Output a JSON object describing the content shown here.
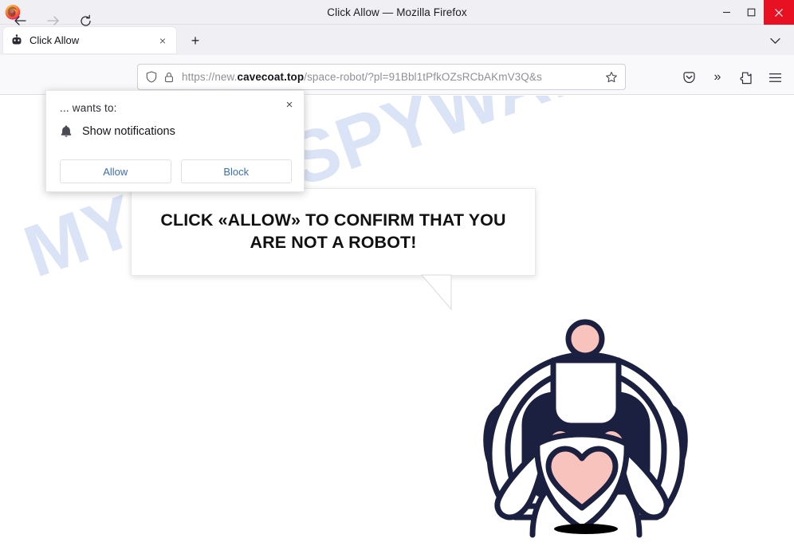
{
  "window": {
    "title": "Click Allow — Mozilla Firefox",
    "minimize_label": "minimize-icon",
    "maximize_label": "maximize-icon",
    "close_label": "close-icon"
  },
  "tabbar": {
    "tab_title": "Click Allow",
    "tab_close": "×",
    "new_tab": "+",
    "list_all_tabs": "chevron-down-icon"
  },
  "toolbar": {
    "back": "back-arrow-icon",
    "forward": "forward-arrow-icon",
    "reload": "reload-icon",
    "pocket": "pocket-icon",
    "more": "»",
    "extensions": "extensions-icon",
    "menu": "hamburger-menu-icon"
  },
  "urlbar": {
    "scheme": "https://",
    "subdomain": "new.",
    "domain": "cavecoat.top",
    "path": "/space-robot/?pl=91Bbl1tPfkOZsRCbAKmV3Q&s",
    "full_url": "https://new.cavecoat.top/space-robot/?pl=91Bbl1tPfkOZsRCbAKmV3Q&s",
    "shield_icon": "tracking-protection-shield-icon",
    "lock_icon": "padlock-icon",
    "bookmark_icon": "star-icon"
  },
  "permission_popup": {
    "origin_text": "... wants to:",
    "permission_label": "Show notifications",
    "bell_icon": "bell-icon",
    "close": "×",
    "allow_label": "Allow",
    "block_label": "Block"
  },
  "page": {
    "bubble_text": "CLICK «ALLOW» TO CONFIRM THAT YOU ARE NOT A ROBOT!",
    "watermark": "MYANTISPYWARE.COM",
    "robot_alt": "space-robot-illustration"
  },
  "colors": {
    "robot_outline": "#1c2040",
    "robot_pink": "#f9c3bd",
    "watermark": "#dbe4f7",
    "accent_blue": "#3b6fb5",
    "close_red": "#e81123"
  }
}
